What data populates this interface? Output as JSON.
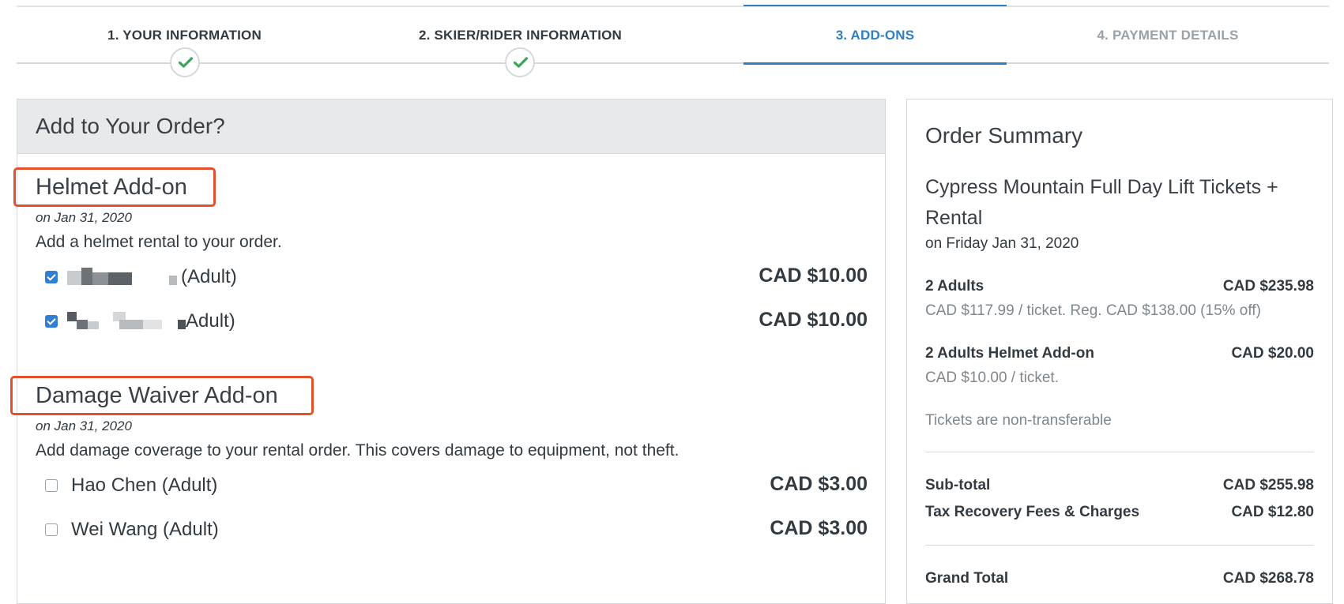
{
  "steps": [
    {
      "label": "1. YOUR INFORMATION",
      "state": "complete"
    },
    {
      "label": "2. SKIER/RIDER INFORMATION",
      "state": "complete"
    },
    {
      "label": "3. ADD-ONS",
      "state": "active"
    },
    {
      "label": "4. PAYMENT DETAILS",
      "state": "inactive"
    }
  ],
  "addons": {
    "heading": "Add to Your Order?",
    "helmet": {
      "title": "Helmet Add-on",
      "date": "on Jan 31, 2020",
      "description": "Add a helmet rental to your order.",
      "rows": [
        {
          "name": "(Adult)",
          "price": "CAD $10.00",
          "checked": true
        },
        {
          "name": "Adult)",
          "price": "CAD $10.00",
          "checked": true
        }
      ]
    },
    "damage": {
      "title": "Damage Waiver Add-on",
      "date": "on Jan 31, 2020",
      "description": "Add damage coverage to your rental order. This covers damage to equipment, not theft.",
      "rows": [
        {
          "name": "Hao Chen (Adult)",
          "price": "CAD $3.00",
          "checked": false
        },
        {
          "name": "Wei Wang (Adult)",
          "price": "CAD $3.00",
          "checked": false
        }
      ]
    }
  },
  "summary": {
    "title": "Order Summary",
    "event": "Cypress Mountain Full Day Lift Tickets + Rental",
    "event_date": "on Friday Jan 31, 2020",
    "items": [
      {
        "label": "2 Adults",
        "amount": "CAD $235.98",
        "detail": "CAD $117.99 / ticket. Reg. CAD $138.00 (15% off)"
      },
      {
        "label": "2 Adults Helmet Add-on",
        "amount": "CAD $20.00",
        "detail": "CAD $10.00 / ticket."
      }
    ],
    "note": "Tickets are non-transferable",
    "subtotal_label": "Sub-total",
    "subtotal": "CAD $255.98",
    "fees_label": "Tax Recovery Fees & Charges",
    "fees": "CAD $12.80",
    "grand_total_label": "Grand Total",
    "grand_total": "CAD $268.78"
  },
  "colors": {
    "accent": "#2f7fc1",
    "check": "#3ba55c",
    "highlight_border": "#e2512c"
  }
}
